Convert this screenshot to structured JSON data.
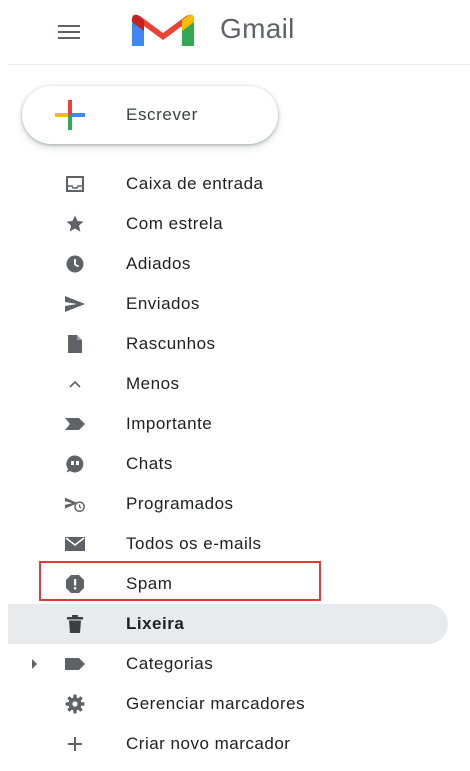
{
  "header": {
    "app_title": "Gmail",
    "menu_icon": "hamburger-menu-icon",
    "logo_icon": "gmail-logo-icon"
  },
  "compose": {
    "label": "Escrever",
    "icon": "compose-plus-icon"
  },
  "nav": {
    "items": [
      {
        "label": "Caixa de entrada",
        "icon": "inbox-icon"
      },
      {
        "label": "Com estrela",
        "icon": "star-icon"
      },
      {
        "label": "Adiados",
        "icon": "snooze-clock-icon"
      },
      {
        "label": "Enviados",
        "icon": "send-icon"
      },
      {
        "label": "Rascunhos",
        "icon": "draft-icon"
      },
      {
        "label": "Menos",
        "icon": "chevron-up-icon"
      },
      {
        "label": "Importante",
        "icon": "important-icon"
      },
      {
        "label": "Chats",
        "icon": "chat-icon"
      },
      {
        "label": "Programados",
        "icon": "scheduled-send-icon"
      },
      {
        "label": "Todos os e-mails",
        "icon": "all-mail-icon"
      },
      {
        "label": "Spam",
        "icon": "spam-icon"
      },
      {
        "label": "Lixeira",
        "icon": "trash-icon",
        "active": true
      },
      {
        "label": "Categorias",
        "icon": "label-icon"
      },
      {
        "label": "Gerenciar marcadores",
        "icon": "settings-gear-icon"
      },
      {
        "label": "Criar novo marcador",
        "icon": "plus-icon"
      }
    ]
  },
  "colors": {
    "icon": "#5f6368",
    "active_bg": "#e8eaed",
    "highlight_border": "#e53935",
    "brand_red": "#ea4335",
    "brand_blue": "#4285f4",
    "brand_green": "#34a853",
    "brand_yellow": "#fbbc04"
  }
}
